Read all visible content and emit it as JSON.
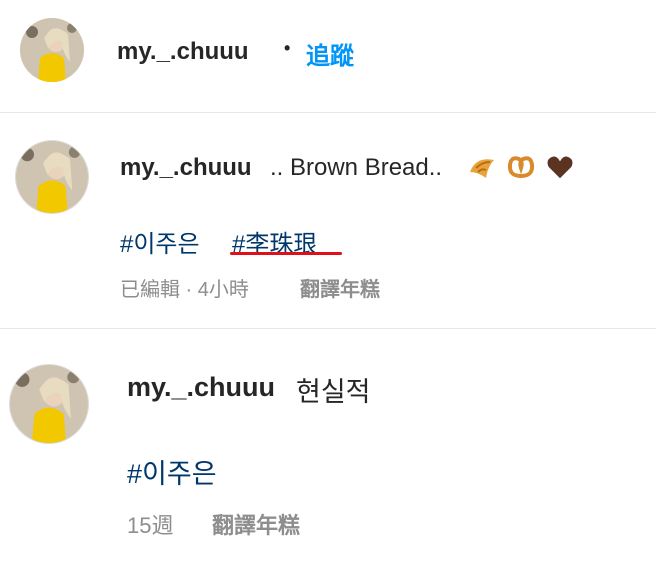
{
  "header": {
    "username": "my._.chuuu",
    "separator": "•",
    "follow_label": "追蹤"
  },
  "comments": [
    {
      "username": "my._.chuuu",
      "text": ".. Brown Bread..",
      "emojis": [
        "croissant-emoji",
        "pretzel-emoji",
        "brown-heart-emoji"
      ],
      "hashtags": [
        "#이주은",
        "#李珠珢"
      ],
      "meta": "已編輯 · 4小時",
      "translate_label": "翻譯年糕"
    },
    {
      "username": "my._.chuuu",
      "text": "현실적",
      "hashtags": [
        "#이주은"
      ],
      "meta": "15週",
      "translate_label": "翻譯年糕"
    }
  ],
  "colors": {
    "follow": "#0095f6",
    "hashtag": "#00376b",
    "meta": "#8e8e8e",
    "annotation_underline": "#e0101a",
    "avatar_shirt": "#f2c800"
  }
}
